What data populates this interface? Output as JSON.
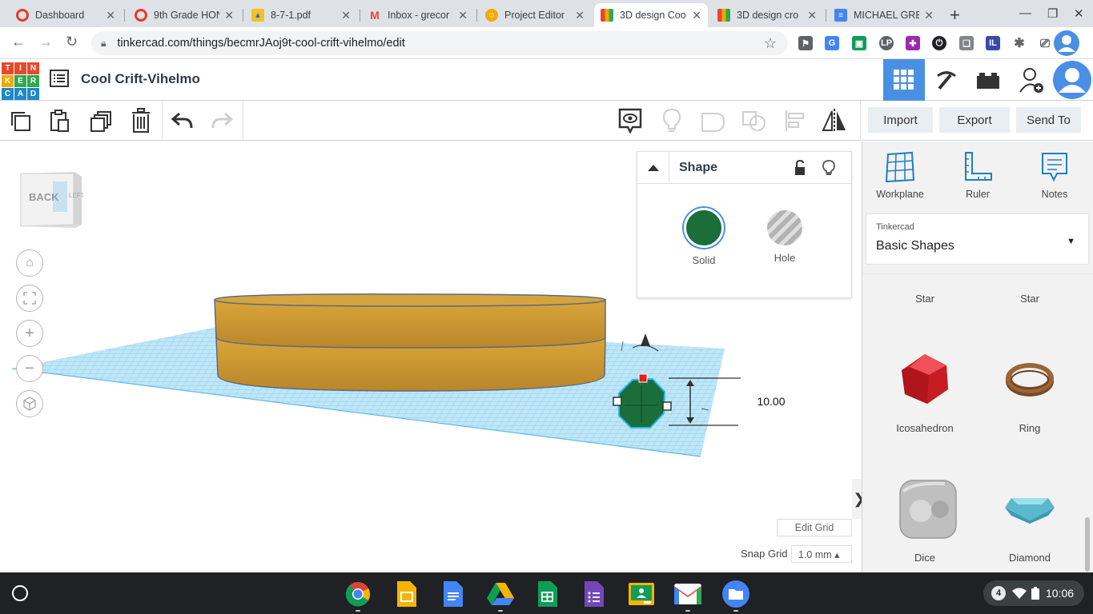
{
  "browser": {
    "tabs": [
      {
        "title": "Dashboard",
        "icon": "canvas-icon",
        "color": "#e33b2e"
      },
      {
        "title": "9th Grade HON",
        "icon": "canvas-icon",
        "color": "#e33b2e"
      },
      {
        "title": "8-7-1.pdf",
        "icon": "drive-icon",
        "color": "#34a853"
      },
      {
        "title": "Inbox - grecor",
        "icon": "gmail-icon",
        "color": "#ea4335"
      },
      {
        "title": "Project Editor",
        "icon": "project-icon",
        "color": "#f2a900"
      },
      {
        "title": "3D design Coo",
        "icon": "tinkercad-icon",
        "color": "#e6492d"
      },
      {
        "title": "3D design cro",
        "icon": "tinkercad-icon",
        "color": "#e6492d"
      },
      {
        "title": "MICHAEL GRE",
        "icon": "docs-icon",
        "color": "#4285f4"
      }
    ],
    "active_tab": 5,
    "url": "tinkercad.com/things/becmrJAoj9t-cool-crift-vihelmo/edit"
  },
  "app": {
    "logo_letters": [
      "T",
      "I",
      "N",
      "K",
      "E",
      "R",
      "C",
      "A",
      "D"
    ],
    "design_title": "Cool Crift-Vihelmo"
  },
  "toolbar": {
    "import_label": "Import",
    "export_label": "Export",
    "sendto_label": "Send To"
  },
  "viewcube": {
    "back_label": "BACK",
    "left_label": "LEFT"
  },
  "inspector": {
    "title": "Shape",
    "solid_label": "Solid",
    "hole_label": "Hole",
    "solid_color": "#1b6e3a"
  },
  "dimension": {
    "value": "10.00"
  },
  "grid": {
    "edit_label": "Edit Grid",
    "snap_label": "Snap Grid",
    "snap_value": "1.0 mm ▴"
  },
  "right_panel": {
    "tools": [
      {
        "label": "Workplane",
        "icon": "workplane-icon"
      },
      {
        "label": "Ruler",
        "icon": "ruler-icon"
      },
      {
        "label": "Notes",
        "icon": "notes-icon"
      }
    ],
    "library_vendor": "Tinkercad",
    "library_name": "Basic Shapes",
    "shapes": [
      {
        "label": "Star"
      },
      {
        "label": "Star"
      },
      {
        "label": "Icosahedron"
      },
      {
        "label": "Ring"
      },
      {
        "label": "Dice"
      },
      {
        "label": "Diamond"
      }
    ]
  },
  "shelf": {
    "notification_count": "4",
    "time": "10:06"
  }
}
